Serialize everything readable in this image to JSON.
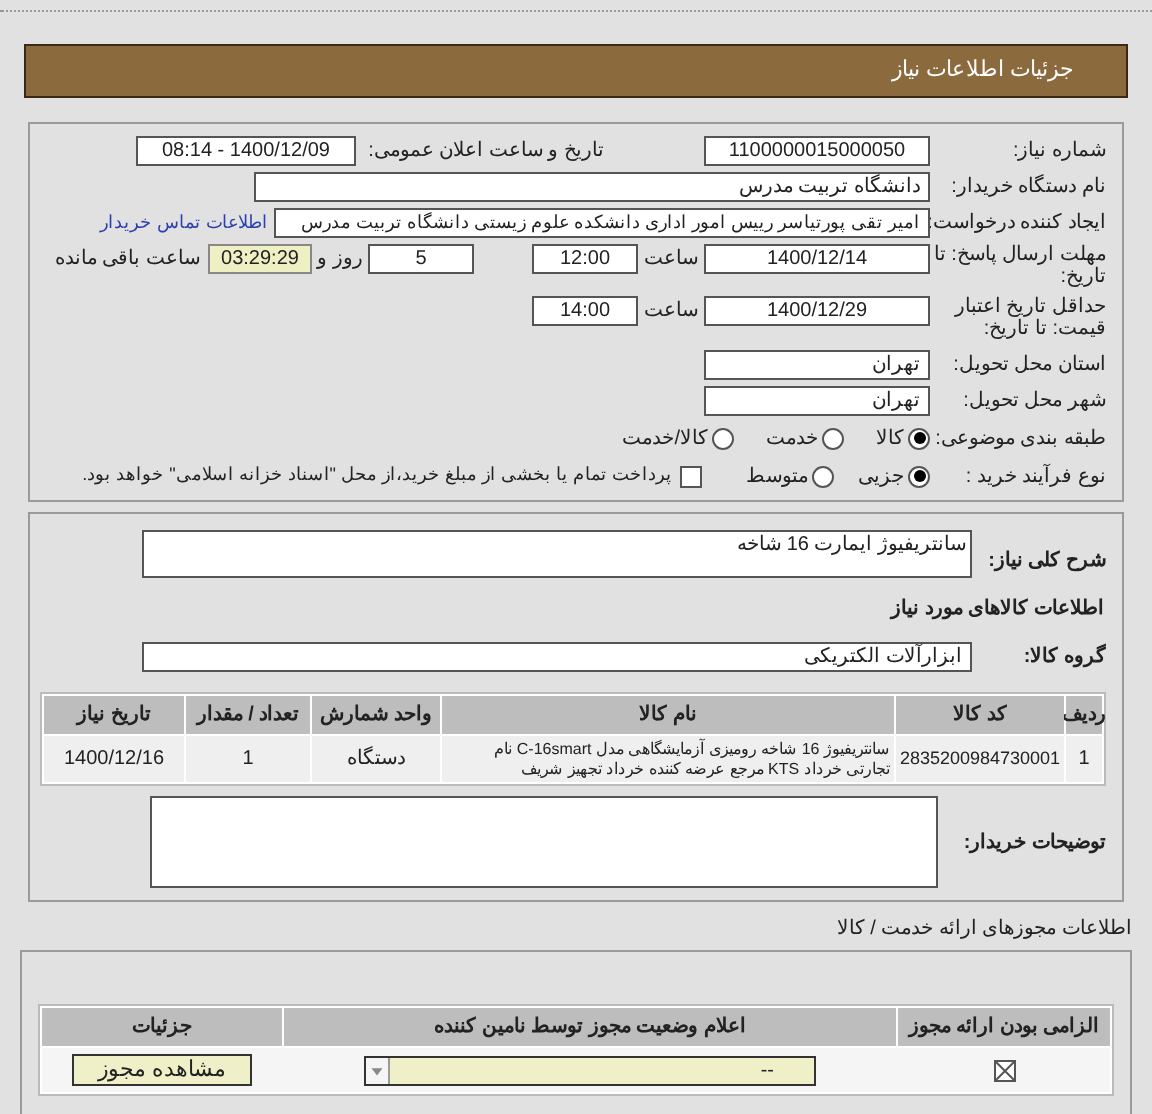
{
  "header": {
    "title": "جزئیات اطلاعات نیاز"
  },
  "need_number": {
    "label": "شماره نیاز:",
    "value": "1100000015000050"
  },
  "announce": {
    "label": "تاریخ و ساعت اعلان عمومی:",
    "value": "1400/12/09 - 08:14"
  },
  "buyer": {
    "label": "نام دستگاه خریدار:",
    "value": "دانشگاه تربیت مدرس"
  },
  "requester": {
    "label": "ایجاد کننده درخواست:",
    "value": "امیر تقی پورتیاسر رییس امور اداری دانشکده علوم زیستی دانشگاه تربیت مدرس",
    "link": "اطلاعات تماس خریدار"
  },
  "deadline": {
    "label": "مهلت ارسال پاسخ: تا تاریخ:",
    "date": "1400/12/14",
    "time_label": "ساعت",
    "time": "12:00",
    "days": "5",
    "days_label": "روز و",
    "remaining": "03:29:29",
    "remaining_label": "ساعت باقی مانده"
  },
  "validity": {
    "label": "حداقل تاریخ اعتبار قیمت: تا تاریخ:",
    "date": "1400/12/29",
    "time_label": "ساعت",
    "time": "14:00"
  },
  "province": {
    "label": "استان محل تحویل:",
    "value": "تهران"
  },
  "city": {
    "label": "شهر محل تحویل:",
    "value": "تهران"
  },
  "category": {
    "label": "طبقه بندی موضوعی:",
    "options": [
      {
        "label": "کالا",
        "selected": true
      },
      {
        "label": "خدمت",
        "selected": false
      },
      {
        "label": "کالا/خدمت",
        "selected": false
      }
    ]
  },
  "purchase_type": {
    "label": "نوع فرآیند خرید :",
    "options": [
      {
        "label": "جزیی",
        "selected": true
      },
      {
        "label": "متوسط",
        "selected": false
      }
    ],
    "payment": {
      "label": "پرداخت تمام یا بخشی از مبلغ خرید،از محل \"اسناد خزانه اسلامی\" خواهد بود.",
      "checked": false
    }
  },
  "description": {
    "label": "شرح کلی نیاز:",
    "value": "سانتریفیوژ ایمارت 16 شاخه"
  },
  "goods_heading": "اطلاعات کالاهای مورد نیاز",
  "goods_group": {
    "label": "گروه کالا:",
    "value": "ابزارآلات الکتریکی"
  },
  "goods_table": {
    "columns": [
      "ردیف",
      "کد کالا",
      "نام کالا",
      "واحد شمارش",
      "تعداد / مقدار",
      "تاریخ نیاز"
    ],
    "rows": [
      [
        "1",
        "2835200984730001",
        "سانتریفیوژ 16 شاخه رومیزی آزمایشگاهی مدل C-16smart نام تجارتی خرداد KTS مرجع عرضه کننده خرداد تجهیز شریف",
        "دستگاه",
        "1",
        "1400/12/16"
      ]
    ]
  },
  "buyer_notes": {
    "label": "توضیحات خریدار:"
  },
  "license_heading": "اطلاعات مجوزهای ارائه خدمت / کالا",
  "license_table": {
    "columns": [
      "الزامی بودن ارائه مجوز",
      "اعلام وضعیت مجوز توسط نامین کننده",
      "جزئیات"
    ],
    "rows": [
      {
        "required": true,
        "status": "--",
        "button": "مشاهده مجوز"
      }
    ]
  }
}
